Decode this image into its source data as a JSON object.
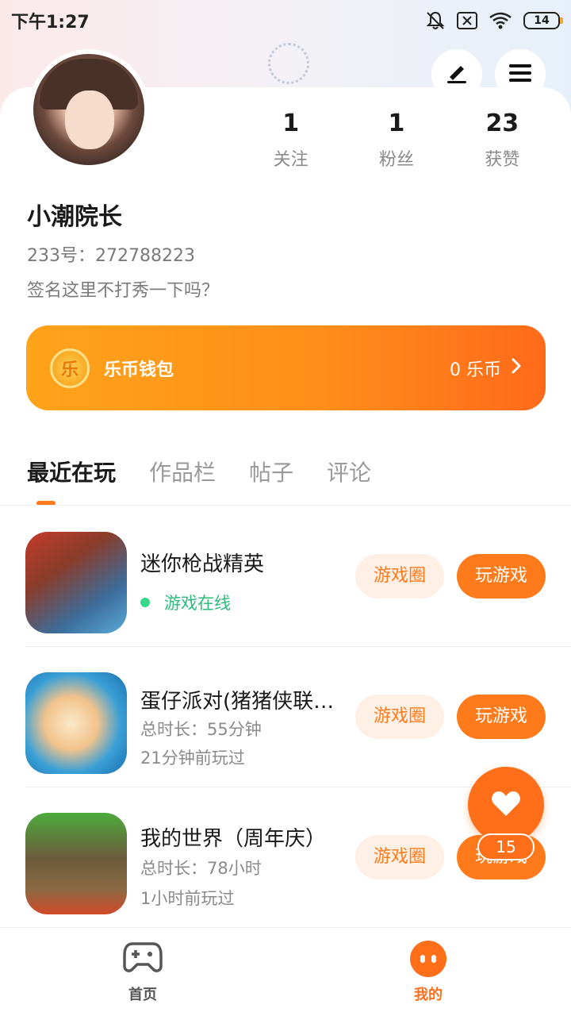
{
  "status_bar": {
    "time": "下午1:27",
    "battery": "14",
    "icons": [
      "mute-bell-icon",
      "close-box-icon",
      "wifi-icon",
      "battery-icon"
    ]
  },
  "header": {
    "edit_icon": "pen-icon",
    "menu_icon": "menu-icon"
  },
  "profile": {
    "stats": [
      {
        "value": "1",
        "label": "关注"
      },
      {
        "value": "1",
        "label": "粉丝"
      },
      {
        "value": "23",
        "label": "获赞"
      }
    ],
    "username": "小潮院长",
    "uid": "233号：272788223",
    "signature": "签名这里不打秀一下吗？"
  },
  "wallet": {
    "coin_char": "乐",
    "label": "乐币钱包",
    "balance": "0 乐币"
  },
  "tabs": [
    {
      "label": "最近在玩",
      "active": true
    },
    {
      "label": "作品栏",
      "active": false
    },
    {
      "label": "帖子",
      "active": false
    },
    {
      "label": "评论",
      "active": false
    }
  ],
  "games": [
    {
      "title": "迷你枪战精英",
      "line1": "游戏在线",
      "line2": "",
      "online": true,
      "circle_label": "游戏圈",
      "play_label": "玩游戏"
    },
    {
      "title": "蛋仔派对(猪猪侠联…",
      "line1": "总时长：55分钟",
      "line2": "21分钟前玩过",
      "online": false,
      "circle_label": "游戏圈",
      "play_label": "玩游戏"
    },
    {
      "title": "我的世界（周年庆）",
      "line1": "总时长：78小时",
      "line2": "1小时前玩过",
      "online": false,
      "circle_label": "游戏圈",
      "play_label": "玩游戏"
    }
  ],
  "fab": {
    "icon": "heart-icon",
    "count": "15"
  },
  "bottom_nav": [
    {
      "label": "首页",
      "icon": "gamepad-icon",
      "active": false
    },
    {
      "label": "我的",
      "icon": "face-icon",
      "active": true
    }
  ],
  "colors": {
    "accent": "#ff7a1a",
    "online": "#2dbd7a"
  }
}
